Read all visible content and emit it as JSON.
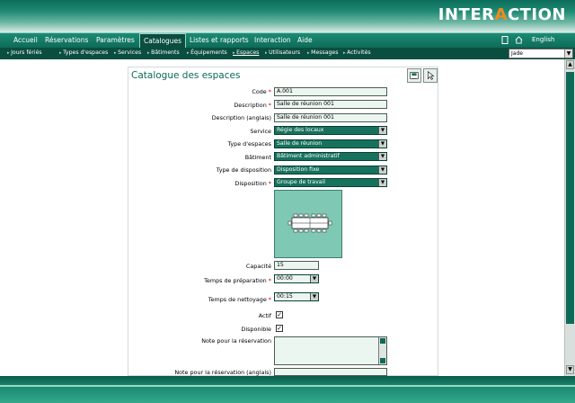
{
  "brand": {
    "logo_pre": "INTER",
    "logo_a": "A",
    "logo_post": "CTION"
  },
  "mainnav": {
    "items": [
      "Accueil",
      "Réservations",
      "Paramètres",
      "Catalogues",
      "Listes et rapports",
      "Interaction",
      "Aide"
    ],
    "active": "Catalogues",
    "language": "English"
  },
  "subnav": {
    "items": [
      "Jours fériés",
      "Types d'espaces",
      "Services",
      "Bâtiments",
      "Équipements",
      "Espaces",
      "Utilisateurs",
      "Messages",
      "Activités"
    ],
    "current": "Espaces",
    "user": "Jade"
  },
  "form": {
    "title": "Catalogue des espaces",
    "labels": {
      "code": "Code",
      "description": "Description",
      "description_en": "Description (anglais)",
      "service": "Service",
      "type_espace": "Type d'espaces",
      "batiment": "Bâtiment",
      "type_disposition": "Type de disposition",
      "disposition": "Disposition",
      "capacite": "Capacité",
      "temps_prep": "Temps de préparation",
      "temps_net": "Temps de nettoyage",
      "actif": "Actif",
      "disponible": "Disponible",
      "note": "Note pour la réservation",
      "note_en": "Note pour la réservation (anglais)"
    },
    "required_mark": "*",
    "values": {
      "code": "A.001",
      "description": "Salle de réunion 001",
      "description_en": "Salle de réunion 001",
      "service": "Régie des locaux",
      "type_espace": "Salle de réunion",
      "batiment": "Bâtiment administratif",
      "type_disposition": "Disposition fixe",
      "disposition": "Groupe de travail",
      "capacite": "15",
      "temps_prep": "00:00",
      "temps_net": "00:15",
      "actif": true,
      "disponible": true
    }
  },
  "colors": {
    "accent": "#0e6a57",
    "brand_orange": "#f08a1c"
  }
}
